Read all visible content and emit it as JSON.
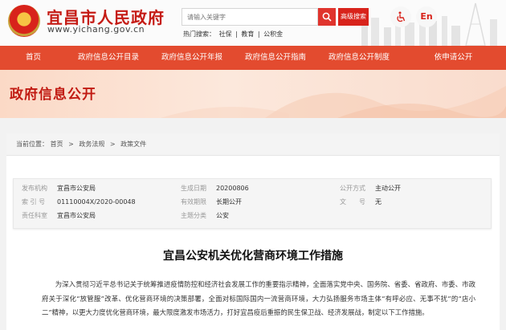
{
  "header": {
    "site_name": "宜昌市人民政府",
    "site_url": "www.yichang.gov.cn",
    "search_placeholder": "请输入关键字",
    "advanced_search_label": "高级搜索",
    "hot_label": "热门搜索：",
    "hot_terms": [
      "社保",
      "教育",
      "公积金"
    ],
    "hot_sep": "|",
    "language_label": "En"
  },
  "nav": {
    "items": [
      {
        "label": "首页"
      },
      {
        "label": "政府信息公开目录"
      },
      {
        "label": "政府信息公开年报"
      },
      {
        "label": "政府信息公开指南"
      },
      {
        "label": "政府信息公开制度"
      },
      {
        "label": "依申请公开"
      }
    ]
  },
  "banner": {
    "title": "政府信息公开"
  },
  "breadcrumb": {
    "prefix": "当前位置：",
    "items": [
      "首页",
      "政务法规",
      "政策文件"
    ],
    "sep": ">"
  },
  "meta": {
    "rows": [
      [
        {
          "label": "发布机构",
          "value": "宜昌市公安局"
        },
        {
          "label": "生成日期",
          "value": "20200806"
        },
        {
          "label": "公开方式",
          "value": "主动公开"
        }
      ],
      [
        {
          "label": "索 引 号",
          "value": "01110004X/2020-00048"
        },
        {
          "label": "有效期限",
          "value": "长期公开"
        },
        {
          "label": "文　　号",
          "value": "无"
        }
      ],
      [
        {
          "label": "责任科室",
          "value": "宜昌市公安局"
        },
        {
          "label": "主题分类",
          "value": "公安"
        }
      ]
    ]
  },
  "document": {
    "title": "宜昌公安机关优化营商环境工作措施",
    "body": "为深入贯彻习近平总书记关于统筹推进疫情防控和经济社会发展工作的重要指示精神，全面落实党中央、国务院、省委、省政府、市委、市政府关于深化“放管服”改革、优化营商环境的决策部署，全面对标国际国内一流营商环境，大力弘扬服务市场主体“有呼必应、无事不扰”的“店小二”精神，以更大力度优化营商环境，最大限度激发市场活力，打好宜昌疫后重振的民生保卫战、经济发展战，制定以下工作措施。"
  },
  "colors": {
    "brand_red": "#d8231b",
    "nav_red": "#e34b2f",
    "banner_text": "#c11a12"
  },
  "icons": [
    "emblem-icon",
    "search-icon",
    "accessibility-icon"
  ]
}
